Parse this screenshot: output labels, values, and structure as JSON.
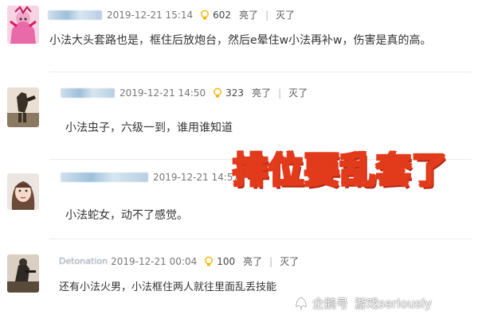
{
  "comments": [
    {
      "user_display": "",
      "timestamp": "2019-12-21 15:14",
      "like_count": "602",
      "like_label": "亮了",
      "dislike_label": "灭了",
      "text": "小法大头套路也是，框住后放炮台，然后e晕住w小法再补w，伤害是真的高。"
    },
    {
      "user_display": "",
      "timestamp": "2019-12-21 14:50",
      "like_count": "323",
      "like_label": "亮了",
      "dislike_label": "灭了",
      "text": "小法虫子，六级一到，谁用谁知道"
    },
    {
      "user_display": "",
      "timestamp": "2019-12-21 14:57",
      "like_count": "",
      "like_label": "",
      "dislike_label": "",
      "text": "小法蛇女，动不了感觉。"
    },
    {
      "user_display": "Detonation",
      "timestamp": "2019-12-21 00:04",
      "like_count": "100",
      "like_label": "亮了",
      "dislike_label": "灭了",
      "text": "还有小法火男，小法框住两人就往里面乱丢技能"
    }
  ],
  "overlay_title": "排位要乱套了",
  "watermark": {
    "brand": "企鹅号",
    "account": "游戏seriously"
  },
  "colors": {
    "overlay_fill": "#ffea00",
    "overlay_stroke": "#e23b1c",
    "bulb": "#f5b400"
  },
  "icons": {
    "like_icon": "lightbulb-icon",
    "watermark_icon": "penguin-logo-icon"
  }
}
